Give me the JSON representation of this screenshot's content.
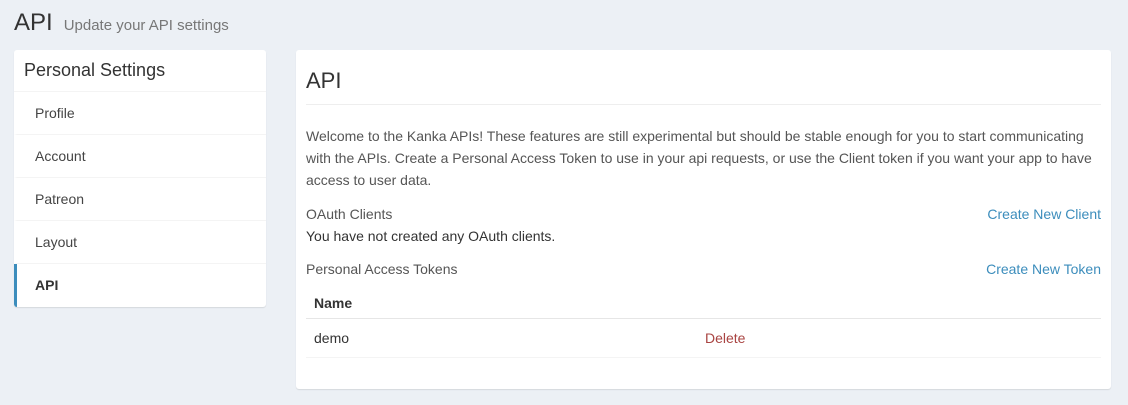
{
  "header": {
    "title": "API",
    "subtitle": "Update your API settings"
  },
  "settings_menu": {
    "title": "Personal Settings",
    "items": [
      {
        "label": "Profile",
        "active": false
      },
      {
        "label": "Account",
        "active": false
      },
      {
        "label": "Patreon",
        "active": false
      },
      {
        "label": "Layout",
        "active": false
      },
      {
        "label": "API",
        "active": true
      }
    ]
  },
  "api_panel": {
    "title": "API",
    "intro": "Welcome to the Kanka APIs! These features are still experimental but should be stable enough for you to start communicating with the APIs. Create a Personal Access Token to use in your api requests, or use the Client token if you want your app to have access to user data.",
    "oauth": {
      "label": "OAuth Clients",
      "create_label": "Create New Client",
      "empty_text": "You have not created any OAuth clients."
    },
    "tokens": {
      "label": "Personal Access Tokens",
      "create_label": "Create New Token",
      "columns": [
        "Name",
        ""
      ],
      "rows": [
        {
          "name": "demo",
          "action": "Delete"
        }
      ]
    }
  },
  "colors": {
    "background": "#ecf0f5",
    "accent": "#3c8dbc",
    "danger": "#a94442"
  }
}
